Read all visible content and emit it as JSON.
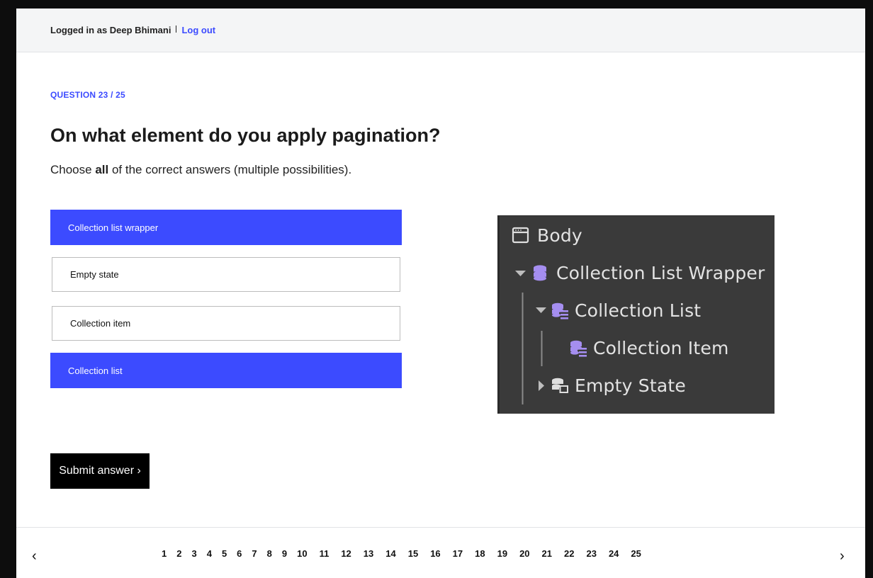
{
  "header": {
    "logged_in_text": "Logged in as Deep Bhimani",
    "logout_label": "Log out"
  },
  "question": {
    "number_label": "QUESTION 23 / 25",
    "title": "On what element do you apply pagination?",
    "hint_prefix": "Choose ",
    "hint_bold": "all",
    "hint_suffix": " of the correct answers (multiple possibilities)."
  },
  "options": [
    {
      "label": "Collection list wrapper",
      "selected": true
    },
    {
      "label": "Empty state",
      "selected": false
    },
    {
      "label": "Collection item",
      "selected": false
    },
    {
      "label": "Collection list",
      "selected": true
    }
  ],
  "submit_label": "Submit answer ›",
  "image_panel": {
    "items": [
      {
        "label": "Body",
        "icon": "body-window-icon"
      },
      {
        "label": "Collection List Wrapper",
        "icon": "collection-wrapper-icon"
      },
      {
        "label": "Collection List",
        "icon": "collection-list-icon"
      },
      {
        "label": "Collection Item",
        "icon": "collection-item-icon"
      },
      {
        "label": "Empty State",
        "icon": "empty-state-icon"
      }
    ],
    "colors": {
      "background": "#3a3a3a",
      "icon_purple": "#a58ef0",
      "text": "#e3e3e3"
    }
  },
  "pagination": {
    "prev_label": "‹",
    "next_label": "›",
    "pages": [
      "1",
      "2",
      "3",
      "4",
      "5",
      "6",
      "7",
      "8",
      "9",
      "10",
      "11",
      "12",
      "13",
      "14",
      "15",
      "16",
      "17",
      "18",
      "19",
      "20",
      "21",
      "22",
      "23",
      "24",
      "25"
    ]
  },
  "colors": {
    "accent": "#3c4bff",
    "topbar_bg": "#f4f5f6"
  }
}
